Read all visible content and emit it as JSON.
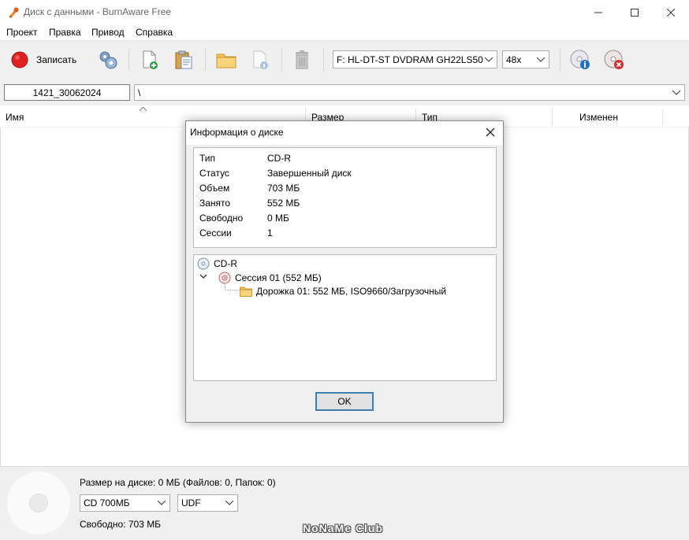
{
  "window": {
    "title": "Диск с данными - BurnAware Free"
  },
  "menu": [
    "Проект",
    "Правка",
    "Привод",
    "Справка"
  ],
  "toolbar": {
    "burn_label": "Записать",
    "drive_value": "F: HL-DT-ST DVDRAM GH22LS50",
    "speed_value": "48x"
  },
  "pathbar": {
    "disc_label": "1421_30062024",
    "path": "\\"
  },
  "columns": [
    "Имя",
    "Размер",
    "Тип",
    "Изменен"
  ],
  "status": {
    "size_info": "Размер на диске: 0 МБ (Файлов: 0, Папок: 0)",
    "disc_type": "CD 700МБ",
    "filesystem": "UDF",
    "free": "Свободно: 703 МБ"
  },
  "dialog": {
    "title": "Информация о диске",
    "info": [
      {
        "key": "Тип",
        "value": "CD-R"
      },
      {
        "key": "Статус",
        "value": "Завершенный диск"
      },
      {
        "key": "Объем",
        "value": "703 МБ"
      },
      {
        "key": "Занято",
        "value": "552 МБ"
      },
      {
        "key": "Свободно",
        "value": "0 МБ"
      },
      {
        "key": "Сессии",
        "value": "1"
      }
    ],
    "tree": {
      "root": "CD-R",
      "session": "Сессия 01 (552 МБ)",
      "track": "Дорожка 01: 552 МБ, ISO9660/Загрузочный"
    },
    "ok_label": "OK"
  },
  "watermark": "NoNaMe Club",
  "colors": {
    "record_red": "#e02020",
    "folder_yellow": "#f3c35a",
    "ok_border": "#3c7fb1",
    "info_blue": "#1f6fc4",
    "cancel_red": "#d32f2f"
  }
}
